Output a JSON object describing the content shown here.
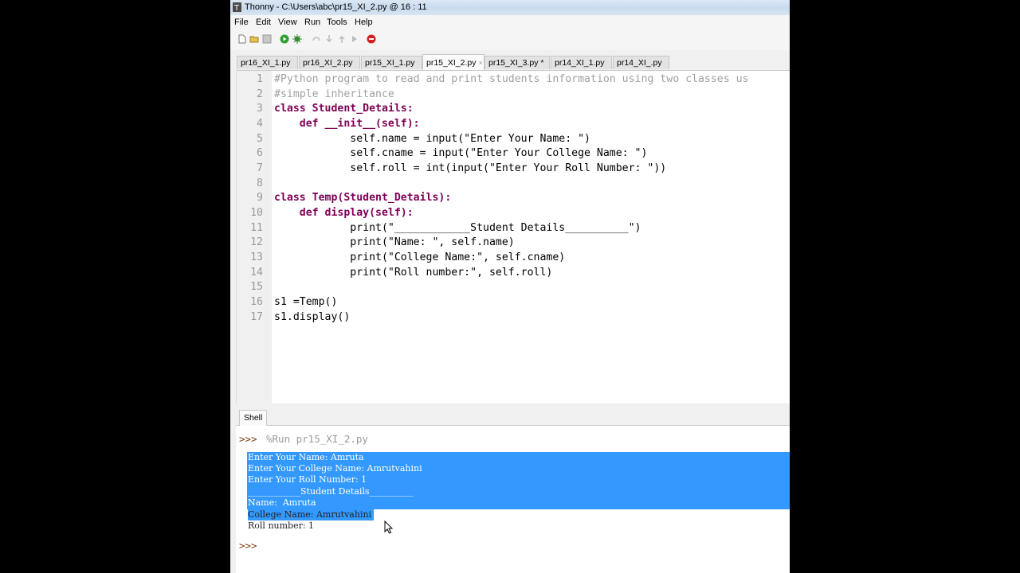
{
  "window": {
    "title": "Thonny  -  C:\\Users\\abc\\pr15_XI_2.py  @  16 : 11"
  },
  "menu": [
    "File",
    "Edit",
    "View",
    "Run",
    "Tools",
    "Help"
  ],
  "toolbar": {
    "icons": [
      "new-file-icon",
      "open-icon",
      "save-icon",
      "run-icon",
      "debug-icon",
      "step-over-icon",
      "step-into-icon",
      "step-out-icon",
      "resume-icon",
      "stop-icon"
    ],
    "colors": {
      "run": "#2e9e2e",
      "stop": "#d42020"
    }
  },
  "tabs": [
    {
      "label": "pr16_XI_1.py"
    },
    {
      "label": "pr16_XI_2.py"
    },
    {
      "label": "pr15_XI_1.py"
    },
    {
      "label": "pr15_XI_2.py",
      "active": true
    },
    {
      "label": "pr15_XI_3.py *"
    },
    {
      "label": "pr14_XI_1.py"
    },
    {
      "label": "pr14_XI_.py"
    }
  ],
  "editor": {
    "line_numbers": [
      "1",
      "2",
      "3",
      "4",
      "5",
      "6",
      "7",
      "8",
      "9",
      "10",
      "11",
      "12",
      "13",
      "14",
      "15",
      "16",
      "17"
    ],
    "lines": [
      "#Python program to read and print students information using two classes us",
      "#simple inheritance",
      "class Student_Details:",
      "    def __init__(self):",
      "            self.name = input(\"Enter Your Name: \")",
      "            self.cname = input(\"Enter Your College Name: \")",
      "            self.roll = int(input(\"Enter Your Roll Number: \"))",
      "",
      "class Temp(Student_Details):",
      "    def display(self):",
      "            print(\"____________Student Details__________\")",
      "            print(\"Name: \", self.name)",
      "            print(\"College Name:\", self.cname)",
      "            print(\"Roll number:\", self.roll)",
      "",
      "s1 =Temp()",
      "s1.display()"
    ]
  },
  "shell": {
    "tab_label": "Shell",
    "prompt": ">>>",
    "run_command": "%Run pr15_XI_2.py",
    "output": [
      "Enter Your Name: Amruta",
      "Enter Your College Name: Amrutvahini",
      "Enter Your Roll Number: 1",
      "____________Student Details__________",
      "Name:  Amruta",
      "College Name: Amrutvahini",
      "Roll number: 1"
    ],
    "selection_color": "#3399ff"
  }
}
